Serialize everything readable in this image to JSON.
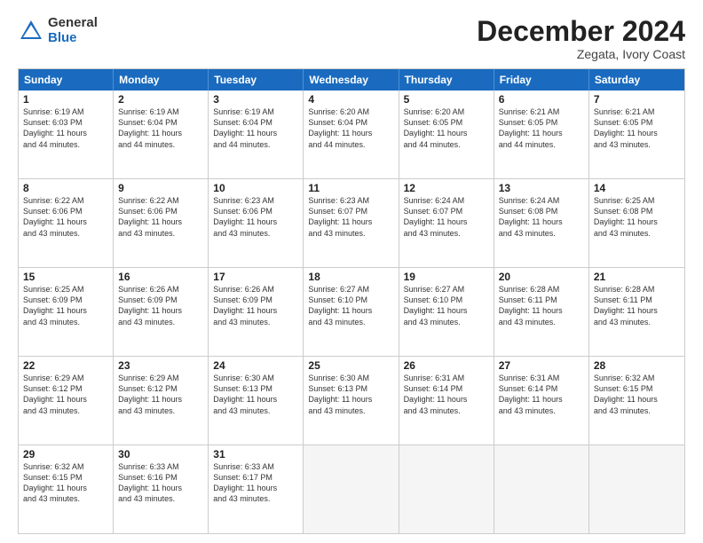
{
  "logo": {
    "general": "General",
    "blue": "Blue"
  },
  "header": {
    "month": "December 2024",
    "location": "Zegata, Ivory Coast"
  },
  "days": [
    "Sunday",
    "Monday",
    "Tuesday",
    "Wednesday",
    "Thursday",
    "Friday",
    "Saturday"
  ],
  "rows": [
    [
      {
        "day": "1",
        "info": "Sunrise: 6:19 AM\nSunset: 6:03 PM\nDaylight: 11 hours\nand 44 minutes."
      },
      {
        "day": "2",
        "info": "Sunrise: 6:19 AM\nSunset: 6:04 PM\nDaylight: 11 hours\nand 44 minutes."
      },
      {
        "day": "3",
        "info": "Sunrise: 6:19 AM\nSunset: 6:04 PM\nDaylight: 11 hours\nand 44 minutes."
      },
      {
        "day": "4",
        "info": "Sunrise: 6:20 AM\nSunset: 6:04 PM\nDaylight: 11 hours\nand 44 minutes."
      },
      {
        "day": "5",
        "info": "Sunrise: 6:20 AM\nSunset: 6:05 PM\nDaylight: 11 hours\nand 44 minutes."
      },
      {
        "day": "6",
        "info": "Sunrise: 6:21 AM\nSunset: 6:05 PM\nDaylight: 11 hours\nand 44 minutes."
      },
      {
        "day": "7",
        "info": "Sunrise: 6:21 AM\nSunset: 6:05 PM\nDaylight: 11 hours\nand 43 minutes."
      }
    ],
    [
      {
        "day": "8",
        "info": "Sunrise: 6:22 AM\nSunset: 6:06 PM\nDaylight: 11 hours\nand 43 minutes."
      },
      {
        "day": "9",
        "info": "Sunrise: 6:22 AM\nSunset: 6:06 PM\nDaylight: 11 hours\nand 43 minutes."
      },
      {
        "day": "10",
        "info": "Sunrise: 6:23 AM\nSunset: 6:06 PM\nDaylight: 11 hours\nand 43 minutes."
      },
      {
        "day": "11",
        "info": "Sunrise: 6:23 AM\nSunset: 6:07 PM\nDaylight: 11 hours\nand 43 minutes."
      },
      {
        "day": "12",
        "info": "Sunrise: 6:24 AM\nSunset: 6:07 PM\nDaylight: 11 hours\nand 43 minutes."
      },
      {
        "day": "13",
        "info": "Sunrise: 6:24 AM\nSunset: 6:08 PM\nDaylight: 11 hours\nand 43 minutes."
      },
      {
        "day": "14",
        "info": "Sunrise: 6:25 AM\nSunset: 6:08 PM\nDaylight: 11 hours\nand 43 minutes."
      }
    ],
    [
      {
        "day": "15",
        "info": "Sunrise: 6:25 AM\nSunset: 6:09 PM\nDaylight: 11 hours\nand 43 minutes."
      },
      {
        "day": "16",
        "info": "Sunrise: 6:26 AM\nSunset: 6:09 PM\nDaylight: 11 hours\nand 43 minutes."
      },
      {
        "day": "17",
        "info": "Sunrise: 6:26 AM\nSunset: 6:09 PM\nDaylight: 11 hours\nand 43 minutes."
      },
      {
        "day": "18",
        "info": "Sunrise: 6:27 AM\nSunset: 6:10 PM\nDaylight: 11 hours\nand 43 minutes."
      },
      {
        "day": "19",
        "info": "Sunrise: 6:27 AM\nSunset: 6:10 PM\nDaylight: 11 hours\nand 43 minutes."
      },
      {
        "day": "20",
        "info": "Sunrise: 6:28 AM\nSunset: 6:11 PM\nDaylight: 11 hours\nand 43 minutes."
      },
      {
        "day": "21",
        "info": "Sunrise: 6:28 AM\nSunset: 6:11 PM\nDaylight: 11 hours\nand 43 minutes."
      }
    ],
    [
      {
        "day": "22",
        "info": "Sunrise: 6:29 AM\nSunset: 6:12 PM\nDaylight: 11 hours\nand 43 minutes."
      },
      {
        "day": "23",
        "info": "Sunrise: 6:29 AM\nSunset: 6:12 PM\nDaylight: 11 hours\nand 43 minutes."
      },
      {
        "day": "24",
        "info": "Sunrise: 6:30 AM\nSunset: 6:13 PM\nDaylight: 11 hours\nand 43 minutes."
      },
      {
        "day": "25",
        "info": "Sunrise: 6:30 AM\nSunset: 6:13 PM\nDaylight: 11 hours\nand 43 minutes."
      },
      {
        "day": "26",
        "info": "Sunrise: 6:31 AM\nSunset: 6:14 PM\nDaylight: 11 hours\nand 43 minutes."
      },
      {
        "day": "27",
        "info": "Sunrise: 6:31 AM\nSunset: 6:14 PM\nDaylight: 11 hours\nand 43 minutes."
      },
      {
        "day": "28",
        "info": "Sunrise: 6:32 AM\nSunset: 6:15 PM\nDaylight: 11 hours\nand 43 minutes."
      }
    ],
    [
      {
        "day": "29",
        "info": "Sunrise: 6:32 AM\nSunset: 6:15 PM\nDaylight: 11 hours\nand 43 minutes."
      },
      {
        "day": "30",
        "info": "Sunrise: 6:33 AM\nSunset: 6:16 PM\nDaylight: 11 hours\nand 43 minutes."
      },
      {
        "day": "31",
        "info": "Sunrise: 6:33 AM\nSunset: 6:17 PM\nDaylight: 11 hours\nand 43 minutes."
      },
      {
        "day": "",
        "info": ""
      },
      {
        "day": "",
        "info": ""
      },
      {
        "day": "",
        "info": ""
      },
      {
        "day": "",
        "info": ""
      }
    ]
  ]
}
